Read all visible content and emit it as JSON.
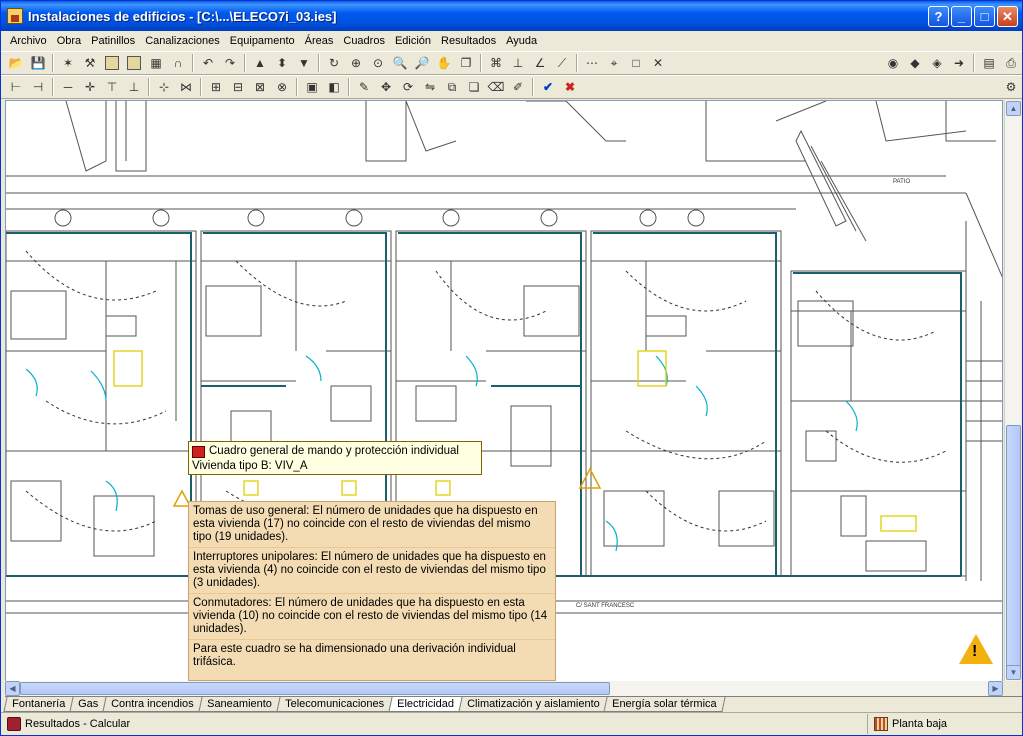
{
  "window": {
    "title": "Instalaciones de edificios - [C:\\...\\ELECO7i_03.ies]"
  },
  "title_buttons": {
    "help": "?",
    "minimize": "_",
    "maximize": "□",
    "close": "✕"
  },
  "menu": [
    "Archivo",
    "Obra",
    "Patinillos",
    "Canalizaciones",
    "Equipamento",
    "Áreas",
    "Cuadros",
    "Edición",
    "Resultados",
    "Ayuda"
  ],
  "tooltip": {
    "title": "Cuadro general de mando y protección individual",
    "subtitle": "Vivienda tipo B: VIV_A"
  },
  "messages": [
    "Tomas de uso general: El número de unidades que ha dispuesto en esta vivienda (17) no coincide con el resto de viviendas del mismo tipo (19 unidades).",
    "Interruptores unipolares: El número de unidades que ha dispuesto en esta vivienda (4) no coincide con el resto de viviendas del mismo tipo (3 unidades).",
    "Conmutadores: El número de unidades que ha dispuesto en esta vivienda (10) no coincide con el resto de viviendas del mismo tipo (14 unidades).",
    "Para este cuadro se ha dimensionado una derivación individual trifásica."
  ],
  "plan_labels": {
    "patio": "PATIO",
    "street": "C/ SANT FRANCESC"
  },
  "tabs": [
    "Fontanería",
    "Gas",
    "Contra incendios",
    "Saneamiento",
    "Telecomunicaciones",
    "Electricidad",
    "Climatización y aislamiento",
    "Energía solar térmica"
  ],
  "active_tab": "Electricidad",
  "status": {
    "left": "Resultados - Calcular",
    "right": "Planta baja"
  },
  "colors": {
    "walls": "#555555",
    "circuits": "#1a5f6a",
    "doors": "#00b0d0",
    "fixtures": "#e0d000",
    "warning": "#f3b10f"
  }
}
